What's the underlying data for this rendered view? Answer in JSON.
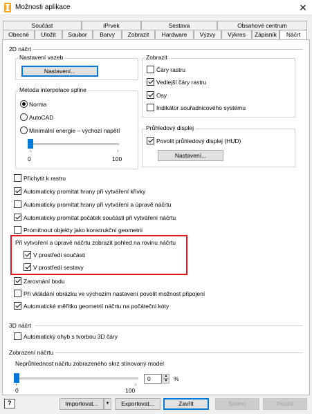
{
  "window": {
    "title": "Možnosti aplikace"
  },
  "tabs_row1": [
    "Součást",
    "iPrvek",
    "Sestava",
    "Obsahové centrum"
  ],
  "tabs_row2": [
    "Obecné",
    "Uložit",
    "Soubor",
    "Barvy",
    "Zobrazit",
    "Hardware",
    "Výzvy",
    "Výkres",
    "Zápisník",
    "Náčrt"
  ],
  "active_tab": "Náčrt",
  "sketch2d": {
    "title": "2D náčrt",
    "constraint": {
      "label": "Nastavení vazeb",
      "button": "Nastavení..."
    },
    "spline": {
      "label": "Metoda interpolace spline",
      "options": [
        "Norma",
        "AutoCAD",
        "Minimální energie – výchozí napětí"
      ],
      "selected": "Norma",
      "slider": {
        "min": "0",
        "max": "100",
        "value": 0
      }
    },
    "display": {
      "label": "Zobrazit",
      "items": [
        {
          "label": "Čáry rastru",
          "checked": false
        },
        {
          "label": "Vedlejší čáry rastru",
          "checked": true
        },
        {
          "label": "Osy",
          "checked": true
        },
        {
          "label": "Indikátor souřadnicového systému",
          "checked": false
        }
      ]
    },
    "hud": {
      "label": "Průhledový displej",
      "checkbox": "Povolit průhledový displej (HUD)",
      "checked": true,
      "button": "Nastavení..."
    },
    "options": [
      {
        "label": "Přichytit k rastru",
        "checked": false
      },
      {
        "label": "Automaticky promítat hrany při vytváření křivky",
        "checked": true
      },
      {
        "label": "Automaticky promítat hrany při vytváření a úpravě náčrtu",
        "checked": false
      },
      {
        "label": "Automaticky promítat počátek součásti při vytváření náčrtu",
        "checked": true
      },
      {
        "label": "Promítnout objekty jako konstrukční geometrii",
        "checked": false
      }
    ],
    "look_at": {
      "label": "Při vytvoření a úpravě náčrtu zobrazit pohled na rovinu náčrtu",
      "items": [
        {
          "label": "V prostředí součásti",
          "checked": true
        },
        {
          "label": "V prostředí sestavy",
          "checked": true
        }
      ]
    },
    "options2": [
      {
        "label": "Zarovnání bodu",
        "checked": true
      },
      {
        "label": "Při vkládání obrázku ve výchozím nastavení povolit možnost připojení",
        "checked": false
      },
      {
        "label": "Automatické měřítko geometrií náčrtu na počáteční kóty",
        "checked": true
      }
    ]
  },
  "sketch3d": {
    "title": "3D náčrt",
    "items": [
      {
        "label": "Automatický ohyb s tvorbou 3D čáry",
        "checked": false
      }
    ]
  },
  "sketch_display": {
    "title": "Zobrazení náčrtu",
    "opacity_label": "Neprůhlednost náčrtu zobrazeného skrz stínovaný model",
    "slider": {
      "min": "0",
      "max": "100",
      "value": 0
    },
    "input_value": "0",
    "unit": "%"
  },
  "footer": {
    "help_icon": "?",
    "import": "Importovat...",
    "export": "Exportovat...",
    "close": "Zavřít",
    "cancel": "Storno",
    "apply": "Použít"
  }
}
